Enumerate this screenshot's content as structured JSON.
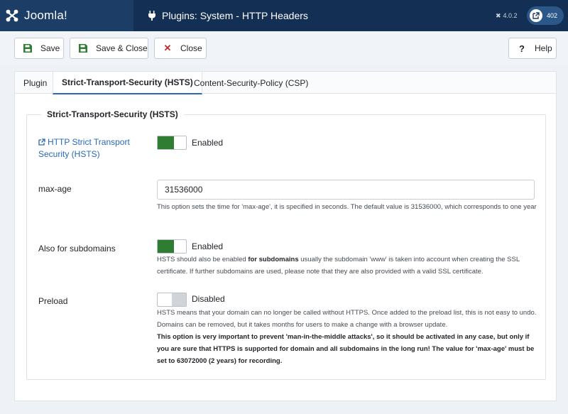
{
  "header": {
    "brand": "Joomla!",
    "title": "Plugins: System - HTTP Headers",
    "version": "4.0.2",
    "notification_count": "402"
  },
  "toolbar": {
    "save_label": "Save",
    "save_close_label": "Save & Close",
    "close_label": "Close",
    "help_label": "Help"
  },
  "tabs": [
    {
      "label": "Plugin"
    },
    {
      "label": "Strict-Transport-Security (HSTS)"
    },
    {
      "label": "Content-Security-Policy (CSP)"
    }
  ],
  "fieldset": {
    "legend": "Strict-Transport-Security (HSTS)"
  },
  "fields": {
    "hsts": {
      "label": "HTTP Strict Transport Security (HSTS)",
      "state": "Enabled"
    },
    "max_age": {
      "label": "max-age",
      "value": "31536000",
      "help": "This option sets the time for 'max-age', it is specified in seconds. The default value is 31536000, which corresponds to one year"
    },
    "subdomains": {
      "label": "Also for subdomains",
      "state": "Enabled",
      "help_pre": "HSTS should also be enabled ",
      "help_bold": "for subdomains",
      "help_post": " usually the subdomain 'www' is taken into account when creating the SSL certificate. If further subdomains are used, please note that they are also provided with a valid SSL certificate."
    },
    "preload": {
      "label": "Preload",
      "state": "Disabled",
      "help": "HSTS means that your domain can no longer be called without HTTPS. Once added to the preload list, this is not easy to undo. Domains can be removed, but it takes months for users to make a change with a browser update.",
      "help_bold": "This option is very important to prevent 'man-in-the-middle attacks', so it should be activated in any case, but only if you are sure that HTTPS is supported for domain and all subdomains in the long run! The value for 'max-age' must be set to 63072000 (2 years) for recording."
    }
  },
  "colors": {
    "header_bg": "#132f53",
    "brand_bg": "#1c3d66",
    "switch_on": "#2f7d32",
    "link": "#2a69b8",
    "close": "#c52827"
  }
}
